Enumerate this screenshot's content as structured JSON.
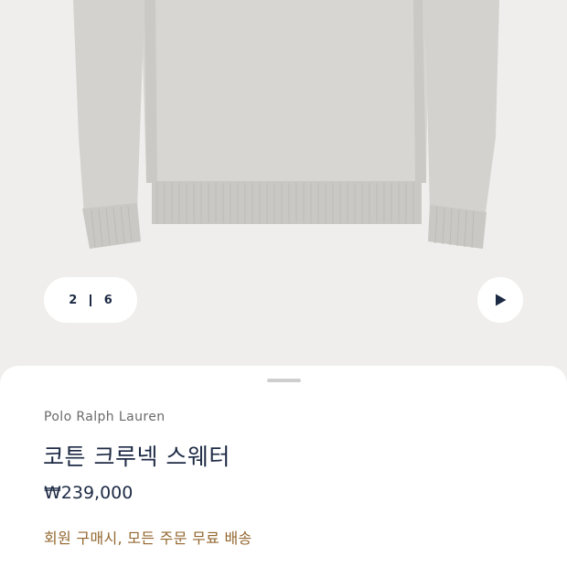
{
  "gallery": {
    "image_icon": "sweater-photo",
    "pager": {
      "current": "2",
      "total": "6"
    },
    "play_icon": "play-icon"
  },
  "product": {
    "brand": "Polo Ralph Lauren",
    "name": "코튼 크루넥 스웨터",
    "price": "₩239,000",
    "promo": "회원 구매시, 모든 주문 무료 배송"
  },
  "colors": {
    "background": "#efeeec",
    "sweater": "#d6d5d2",
    "navy": "#1d2a44",
    "promo": "#93672f"
  }
}
